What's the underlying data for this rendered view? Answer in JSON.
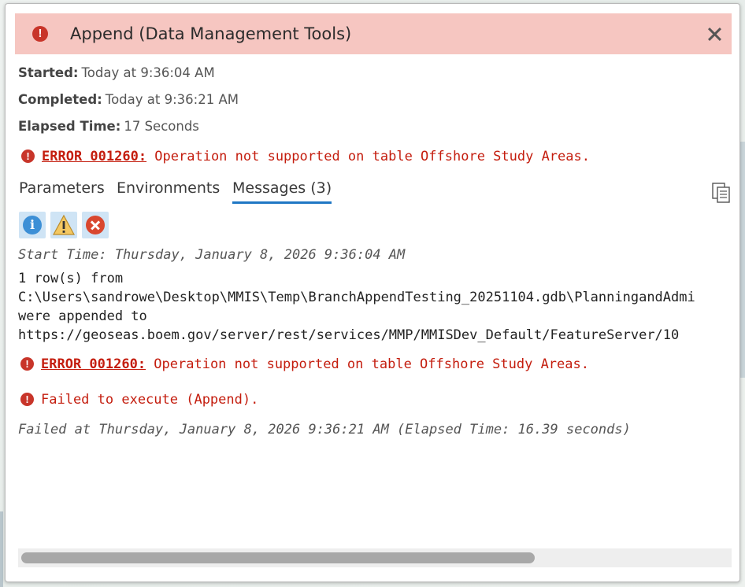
{
  "dialog": {
    "title": "Append (Data Management Tools)",
    "header_icon": "error-icon",
    "close_icon": "close-icon",
    "header_color": "#f6c6c1"
  },
  "info": {
    "started_label": "Started:",
    "started_value": "Today at 9:36:04 AM",
    "completed_label": "Completed:",
    "completed_value": "Today at 9:36:21 AM",
    "elapsed_label": "Elapsed Time:",
    "elapsed_value": "17 Seconds"
  },
  "summary_error": {
    "code": "ERROR 001260:",
    "text": " Operation not supported on table Offshore Study Areas."
  },
  "tabs": [
    {
      "label": "Parameters",
      "active": false
    },
    {
      "label": "Environments",
      "active": false
    },
    {
      "label": "Messages (3)",
      "active": true
    }
  ],
  "filters": [
    {
      "name": "info-filter",
      "icon": "info-icon"
    },
    {
      "name": "warning-filter",
      "icon": "warning-icon"
    },
    {
      "name": "error-filter",
      "icon": "error-icon"
    }
  ],
  "messages": {
    "start_time": "Start Time: Thursday, January 8, 2026 9:36:04 AM",
    "line1": "1 row(s) from",
    "line2": "C:\\Users\\sandrowe\\Desktop\\MMIS\\Temp\\BranchAppendTesting_20251104.gdb\\PlanningandAdmi",
    "line3": "were appended to",
    "line4": "https://geoseas.boem.gov/server/rest/services/MMP/MMISDev_Default/FeatureServer/10",
    "error1_code": "ERROR 001260:",
    "error1_text": " Operation not supported on table Offshore Study Areas.",
    "error2_text": "Failed to execute (Append).",
    "failed_at": "Failed at Thursday, January 8, 2026 9:36:21 AM (Elapsed Time: 16.39 seconds)"
  },
  "colors": {
    "error": "#c41d0e",
    "accent": "#1f77c4"
  }
}
